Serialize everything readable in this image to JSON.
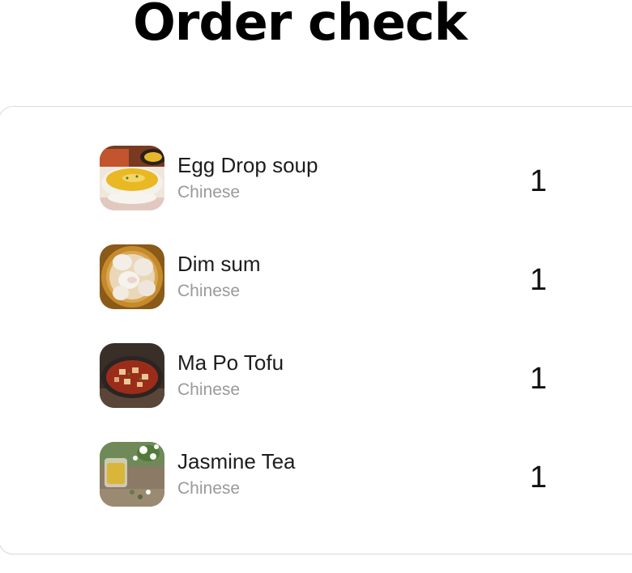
{
  "header": {
    "title": "Order check"
  },
  "order": {
    "items": [
      {
        "name": "Egg Drop soup",
        "cuisine": "Chinese",
        "quantity": "1",
        "image": "egg-drop-soup-photo"
      },
      {
        "name": "Dim sum",
        "cuisine": "Chinese",
        "quantity": "1",
        "image": "dim-sum-photo"
      },
      {
        "name": "Ma Po Tofu",
        "cuisine": "Chinese",
        "quantity": "1",
        "image": "ma-po-tofu-photo"
      },
      {
        "name": "Jasmine Tea",
        "cuisine": "Chinese",
        "quantity": "1",
        "image": "jasmine-tea-photo"
      }
    ]
  },
  "colors": {
    "title": "#000000",
    "item_name": "#1d1d1d",
    "subtitle": "#9a9a9a",
    "card_border": "#dcdcdc"
  }
}
